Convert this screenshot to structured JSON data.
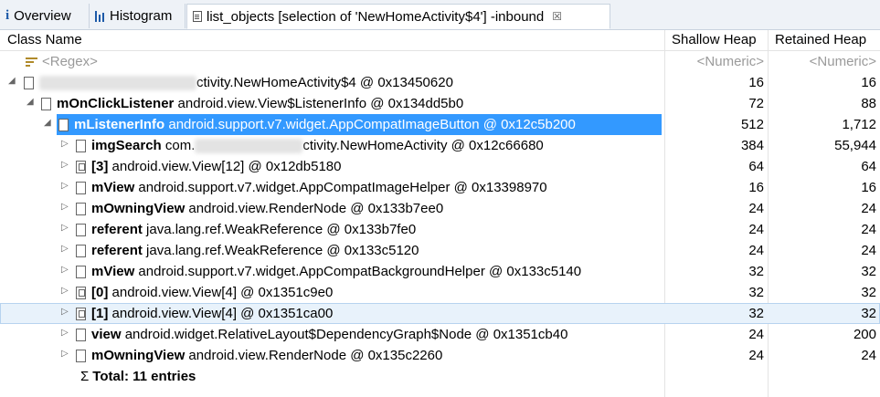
{
  "tabs": [
    {
      "label": "Overview"
    },
    {
      "label": "Histogram"
    },
    {
      "label": "list_objects [selection of 'NewHomeActivity$4'] -inbound",
      "close": "☒"
    }
  ],
  "columns": {
    "class_name": "Class Name",
    "shallow": "Shallow Heap",
    "retained": "Retained Heap"
  },
  "filter_row": {
    "regex": "<Regex>",
    "shallow": "<Numeric>",
    "retained": "<Numeric>"
  },
  "rows": [
    {
      "name": "",
      "desc": "ctivity.NewHomeActivity$4 @ 0x13450620",
      "shallow": "16",
      "retained": "16"
    },
    {
      "name": "mOnClickListener",
      "desc": "android.view.View$ListenerInfo @ 0x134dd5b0",
      "shallow": "72",
      "retained": "88"
    },
    {
      "name": "mListenerInfo",
      "desc": "android.support.v7.widget.AppCompatImageButton @ 0x12c5b200",
      "shallow": "512",
      "retained": "1,712"
    },
    {
      "name": "imgSearch",
      "desc_prefix": "com.",
      "desc": "ctivity.NewHomeActivity @ 0x12c66680",
      "shallow": "384",
      "retained": "55,944"
    },
    {
      "name": "[3]",
      "desc": "android.view.View[12] @ 0x12db5180",
      "shallow": "64",
      "retained": "64"
    },
    {
      "name": "mView",
      "desc": "android.support.v7.widget.AppCompatImageHelper @ 0x13398970",
      "shallow": "16",
      "retained": "16"
    },
    {
      "name": "mOwningView",
      "desc": "android.view.RenderNode @ 0x133b7ee0",
      "shallow": "24",
      "retained": "24"
    },
    {
      "name": "referent",
      "desc": "java.lang.ref.WeakReference @ 0x133b7fe0",
      "shallow": "24",
      "retained": "24"
    },
    {
      "name": "referent",
      "desc": "java.lang.ref.WeakReference @ 0x133c5120",
      "shallow": "24",
      "retained": "24"
    },
    {
      "name": "mView",
      "desc": "android.support.v7.widget.AppCompatBackgroundHelper @ 0x133c5140",
      "shallow": "32",
      "retained": "32"
    },
    {
      "name": "[0]",
      "desc": "android.view.View[4] @ 0x1351c9e0",
      "shallow": "32",
      "retained": "32"
    },
    {
      "name": "[1]",
      "desc": "android.view.View[4] @ 0x1351ca00",
      "shallow": "32",
      "retained": "32"
    },
    {
      "name": "view",
      "desc": "android.widget.RelativeLayout$DependencyGraph$Node @ 0x1351cb40",
      "shallow": "24",
      "retained": "200"
    },
    {
      "name": "mOwningView",
      "desc": "android.view.RenderNode @ 0x135c2260",
      "shallow": "24",
      "retained": "24"
    }
  ],
  "total": {
    "symbol": "Σ",
    "label": "Total: 11 entries"
  },
  "colors": {
    "selection": "#3399ff",
    "highlight": "#e8f2fb",
    "tabbar": "#eef2f7"
  }
}
